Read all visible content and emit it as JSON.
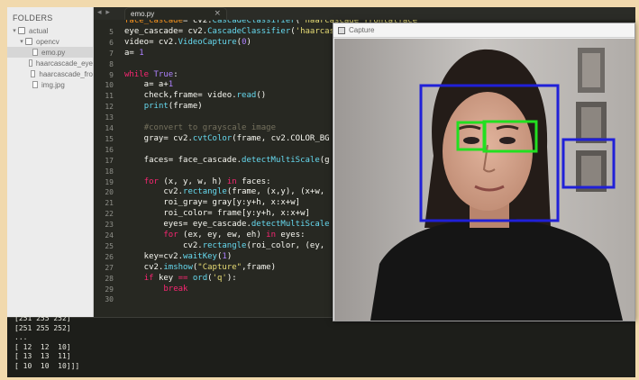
{
  "sidebar": {
    "header": "FOLDERS",
    "items": [
      {
        "label": "actual",
        "kind": "folder",
        "arrow": "▾",
        "indent": 0
      },
      {
        "label": "opencv",
        "kind": "folder",
        "arrow": "▾",
        "indent": 1
      },
      {
        "label": "emo.py",
        "kind": "file",
        "arrow": "",
        "indent": 2,
        "selected": true
      },
      {
        "label": "haarcascade_eye",
        "kind": "file",
        "arrow": "",
        "indent": 2
      },
      {
        "label": "haarcascade_fro",
        "kind": "file",
        "arrow": "",
        "indent": 2
      },
      {
        "label": "img.jpg",
        "kind": "file",
        "arrow": "",
        "indent": 2
      }
    ]
  },
  "tabbar": {
    "nav": "◂ ▸",
    "tab_label": "emo.py",
    "tab_close": "×"
  },
  "editor": {
    "lines": [
      {
        "n": "",
        "html": "<span class=\"vr\">face_cascade</span>= cv2.<span class=\"fn\">CascadeClassifier</span>(<span class=\"st\">'haarcascade_frontalface</span>"
      },
      {
        "n": "5",
        "html": "eye_cascade= cv2.<span class=\"fn\">CascadeClassifier</span>(<span class=\"st\">'haarcas</span>"
      },
      {
        "n": "6",
        "html": "video= cv2.<span class=\"fn\">VideoCapture</span>(<span class=\"nm\">0</span>)"
      },
      {
        "n": "7",
        "html": "a= <span class=\"nm\">1</span>"
      },
      {
        "n": "8",
        "html": ""
      },
      {
        "n": "9",
        "html": "<span class=\"kw\">while</span> <span class=\"nm\">True</span>:"
      },
      {
        "n": "10",
        "html": "    a= a+<span class=\"nm\">1</span>"
      },
      {
        "n": "11",
        "html": "    check,frame= video.<span class=\"fn\">read</span>()"
      },
      {
        "n": "12",
        "html": "    <span class=\"fn\">print</span>(frame)"
      },
      {
        "n": "13",
        "html": ""
      },
      {
        "n": "14",
        "html": "    <span class=\"cm\">#convert to grayscale image</span>"
      },
      {
        "n": "15",
        "html": "    gray= cv2.<span class=\"fn\">cvtColor</span>(frame, cv2.COLOR_BG"
      },
      {
        "n": "16",
        "html": ""
      },
      {
        "n": "17",
        "html": "    faces= face_cascade.<span class=\"fn\">detectMultiScale</span>(g"
      },
      {
        "n": "18",
        "html": ""
      },
      {
        "n": "19",
        "html": "    <span class=\"kw\">for</span> (x, y, w, h) <span class=\"kw\">in</span> faces:"
      },
      {
        "n": "20",
        "html": "        cv2.<span class=\"fn\">rectangle</span>(frame, (x,y), (x+w,"
      },
      {
        "n": "21",
        "html": "        roi_gray= gray[y:y+h, x:x+w]"
      },
      {
        "n": "22",
        "html": "        roi_color= frame[y:y+h, x:x+w]"
      },
      {
        "n": "23",
        "html": "        eyes= eye_cascade.<span class=\"fn\">detectMultiScale</span>"
      },
      {
        "n": "24",
        "html": "        <span class=\"kw\">for</span> (ex, ey, ew, eh) <span class=\"kw\">in</span> eyes:"
      },
      {
        "n": "25",
        "html": "            cv2.<span class=\"fn\">rectangle</span>(roi_color, (ey,"
      },
      {
        "n": "26",
        "html": "    key=cv2.<span class=\"fn\">waitKey</span>(<span class=\"nm\">1</span>)"
      },
      {
        "n": "27",
        "html": "    cv2.<span class=\"fn\">imshow</span>(<span class=\"st\">\"Capture\"</span>,frame)"
      },
      {
        "n": "28",
        "html": "    <span class=\"kw\">if</span> key <span class=\"kw\">==</span> <span class=\"fn\">ord</span>(<span class=\"st\">'q'</span>):"
      },
      {
        "n": "29",
        "html": "        <span class=\"kw\">break</span>"
      },
      {
        "n": "30",
        "html": ""
      }
    ]
  },
  "console": {
    "lines": [
      "[251 255 252]",
      "[251 255 252]",
      "...",
      "[ 12  12  10]",
      "[ 13  13  11]",
      "[ 10  10  10]]]"
    ]
  },
  "capture_window": {
    "title": "Capture",
    "face_box_color": "#2020d8",
    "eye_box_color": "#22e020"
  }
}
